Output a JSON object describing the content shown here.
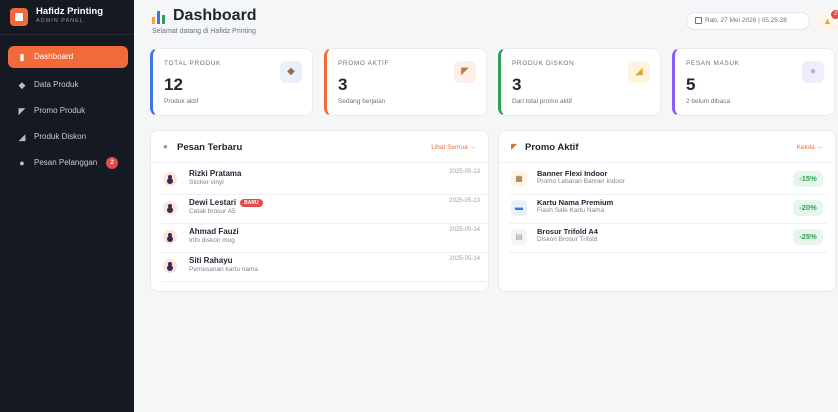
{
  "brand": {
    "name": "Hafidz Printing",
    "subtitle": "ADMIN PANEL"
  },
  "sidebar": {
    "items": [
      {
        "label": "Dashboard",
        "icon": "chart-icon",
        "active": true
      },
      {
        "label": "Data Produk",
        "icon": "box-icon",
        "active": false
      },
      {
        "label": "Promo Produk",
        "icon": "megaphone-icon",
        "active": false
      },
      {
        "label": "Produk Diskon",
        "icon": "tag-icon",
        "active": false
      },
      {
        "label": "Pesan Pelanggan",
        "icon": "chat-icon",
        "active": false,
        "badge": "2"
      }
    ]
  },
  "header": {
    "title": "Dashboard",
    "subtitle": "Selamat datang di Hafidz Printing",
    "date_text": "Rab, 27 Mei 2026 | 05.25.28",
    "notification_count": "2"
  },
  "stats": [
    {
      "label": "TOTAL PRODUK",
      "value": "12",
      "desc": "Produk aktif",
      "color": "#3d74e6",
      "icon": "box-icon"
    },
    {
      "label": "PROMO AKTIF",
      "value": "3",
      "desc": "Sedang berjalan",
      "color": "#f26a3a",
      "icon": "megaphone-icon"
    },
    {
      "label": "PRODUK DISKON",
      "value": "3",
      "desc": "Dari total promo aktif",
      "color": "#2f9e57",
      "icon": "tag-icon"
    },
    {
      "label": "PESAN MASUK",
      "value": "5",
      "desc": "2 belum dibaca",
      "color": "#8a5cf6",
      "icon": "chat-icon"
    }
  ],
  "messages_panel": {
    "title": "Pesan Terbaru",
    "link": "Lihat Semua →",
    "items": [
      {
        "name": "Rizki Pratama",
        "subject": "Sticker vinyl",
        "date": "2025-05-13",
        "is_new": false
      },
      {
        "name": "Dewi Lestari",
        "subject": "Cetak brosur A5",
        "date": "2025-05-13",
        "is_new": true,
        "badge": "BARU"
      },
      {
        "name": "Ahmad Fauzi",
        "subject": "Info diskon mug",
        "date": "2025-05-14",
        "is_new": false
      },
      {
        "name": "Siti Rahayu",
        "subject": "Pemesanan kartu nama",
        "date": "2025-05-14",
        "is_new": false
      }
    ]
  },
  "promo_panel": {
    "title": "Promo Aktif",
    "link": "Kelola →",
    "items": [
      {
        "name": "Banner Flexi Indoor",
        "subtitle": "Promo Lebaran Banner Indoor",
        "discount": "-15%"
      },
      {
        "name": "Kartu Nama Premium",
        "subtitle": "Flash Sale Kartu Nama",
        "discount": "-20%"
      },
      {
        "name": "Brosur Trifold A4",
        "subtitle": "Diskon Brosur Trifold",
        "discount": "-25%"
      }
    ]
  },
  "colors": {
    "accent": "#f26a3a",
    "sidebar_bg": "#151922",
    "success": "#2f9e57",
    "danger": "#e5484d"
  }
}
